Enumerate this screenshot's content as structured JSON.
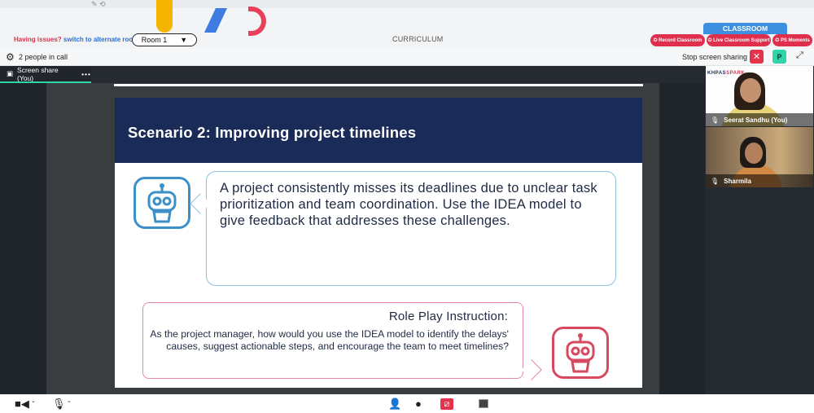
{
  "platform": {
    "issues_text": "Having issues?",
    "issues_link": "switch to alternate room",
    "room_label": "Room 1",
    "room_chevron": "▼",
    "section_title": "CURRICULUM",
    "classroom_tab": "CLASSROOM",
    "record_button": "✪ Record Classroom",
    "support_button": "✪ Live Classroom Support",
    "moments_button": "✪ PS Moments",
    "brand_colors": {
      "red": "#e02e4d",
      "blue": "#3d8fe0",
      "yellow": "#f5b400"
    }
  },
  "call_bar": {
    "settings_icon": "gear-icon",
    "people_count": "2 people in call",
    "stop_sharing_label": "Stop screen sharing",
    "stop_icon": "✕",
    "avatar_initial": "P",
    "expand_icon": "⤢"
  },
  "screen_share": {
    "label": "Screen share (You)",
    "more_icon": "•••"
  },
  "slide": {
    "title": "Scenario 2: Improving project timelines",
    "scenario_text": "A project consistently misses its deadlines due to unclear task prioritization and team coordination. Use the IDEA model to give feedback that addresses these challenges.",
    "roleplay_heading": "Role Play Instruction:",
    "roleplay_text": "As the project manager, how would you use the IDEA model to identify the delays' causes, suggest actionable steps, and encourage the team to meet timelines?",
    "header_color": "#1a2b58"
  },
  "participants": [
    {
      "name": "Seerat Sandhu (You)",
      "banner_blue": "KHPAS",
      "banner_red": "SPARK"
    },
    {
      "name": "Sharmila"
    }
  ],
  "bottom_bar": {
    "camera_icon": "camera-icon",
    "mic_icon": "microphone-icon",
    "participants_icon": "person-icon",
    "chat_icon": "chat-icon",
    "share_icon": "screen-share-icon",
    "layout_icon": "layout-icon"
  }
}
